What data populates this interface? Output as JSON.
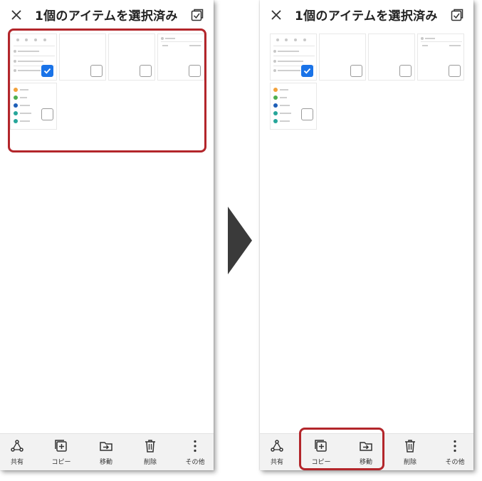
{
  "topbar": {
    "title": "1個のアイテムを選択済み",
    "close_icon": "close-icon",
    "select_all_icon": "select-all-icon"
  },
  "toolbar": {
    "share_label": "共有",
    "copy_label": "コピー",
    "move_label": "移動",
    "delete_label": "削除",
    "more_label": "その他"
  },
  "thumbnails": [
    {
      "checked": true
    },
    {
      "checked": false
    },
    {
      "checked": false
    },
    {
      "checked": false
    },
    {
      "checked": false
    }
  ],
  "colors": {
    "accent": "#1a73e8",
    "highlight": "#b3262b",
    "arrow": "#3a3a3a"
  }
}
